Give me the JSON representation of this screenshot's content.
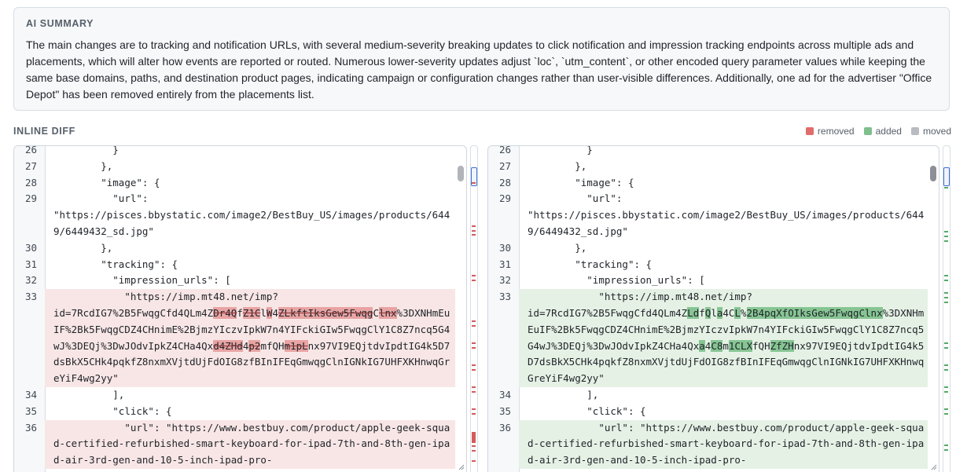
{
  "summary": {
    "title": "AI SUMMARY",
    "text": "The main changes are to tracking and notification URLs, with several medium-severity breaking updates to click notification and impression tracking endpoints across multiple ads and placements, which will alter how events are reported or routed. Numerous lower-severity updates adjust `loc`, `utm_content`, or other encoded query parameter values while keeping the same base domains, paths, and destination product pages, indicating campaign or configuration changes rather than user-visible differences. Additionally, one ad for the advertiser \"Office Depot\" has been removed entirely from the placements list."
  },
  "diff": {
    "title": "INLINE DIFF",
    "legend": [
      {
        "label": "removed",
        "color": "#e06c6c"
      },
      {
        "label": "added",
        "color": "#7fbf8c"
      },
      {
        "label": "moved",
        "color": "#b8bcc2"
      }
    ],
    "colors": {
      "removed_bg": "#f8e6e6",
      "added_bg": "#e6f1e6",
      "removed_hl": "#e9a3a3",
      "added_hl": "#86c593"
    },
    "left": [
      {
        "n": "26",
        "t": "normal",
        "segs": [
          [
            "",
            "          }"
          ]
        ]
      },
      {
        "n": "27",
        "t": "normal",
        "segs": [
          [
            "",
            "        },"
          ]
        ]
      },
      {
        "n": "28",
        "t": "normal",
        "segs": [
          [
            "",
            "        \"image\": {"
          ]
        ]
      },
      {
        "n": "29",
        "t": "normal",
        "segs": [
          [
            "",
            "          \"url\":\n\"https://pisces.bbystatic.com/image2/BestBuy_US/images/products/6449/6449432_sd.jpg\""
          ]
        ]
      },
      {
        "n": "30",
        "t": "normal",
        "segs": [
          [
            "",
            "        },"
          ]
        ]
      },
      {
        "n": "31",
        "t": "normal",
        "segs": [
          [
            "",
            "        \"tracking\": {"
          ]
        ]
      },
      {
        "n": "32",
        "t": "normal",
        "segs": [
          [
            "",
            "          \"impression_urls\": ["
          ]
        ]
      },
      {
        "n": "33",
        "t": "del",
        "segs": [
          [
            "",
            "            \"https://imp.mt48.net/imp?\nid=7RcdIG7%2B5FwqgCfd4QLm4Z"
          ],
          [
            "x",
            "Dr4Q"
          ],
          [
            "",
            "f"
          ],
          [
            "x",
            "Z1C"
          ],
          [
            "",
            "l"
          ],
          [
            "x",
            "W"
          ],
          [
            "",
            "4"
          ],
          [
            "x",
            "ZLkftIksGew5Fwqg"
          ],
          [
            "",
            "C"
          ],
          [
            "x",
            "lnx"
          ],
          [
            "",
            "%3DXNHmEuIF%2Bk5FwqgCDZ4CHnimE%2BjmzYIczvIpkW7n4YIFckiGIw5FwqgClY1C8Z7ncq5G4wJ%3DEQj%3DwJOdvIpkZ4CHa4Qx"
          ],
          [
            "x",
            "d4ZHd"
          ],
          [
            "",
            "4"
          ],
          [
            "x",
            "p2"
          ],
          [
            "",
            "mfQH"
          ],
          [
            "x",
            "m1pL"
          ],
          [
            "",
            "nx97VI9EQjtdvIpdtIG4k5D7dsBkX5CHk4pqkfZ8nxmXVjtdUjFdOIG8zfBInIFEqGmwqgClnIGNkIG7UHFXKHnwqGreYiF4wg2yy\""
          ]
        ]
      },
      {
        "n": "34",
        "t": "normal",
        "segs": [
          [
            "",
            "          ],"
          ]
        ]
      },
      {
        "n": "35",
        "t": "normal",
        "segs": [
          [
            "",
            "          \"click\": {"
          ]
        ]
      },
      {
        "n": "36",
        "t": "del",
        "segs": [
          [
            "",
            "            \"url\": \"https://www.bestbuy.com/product/apple-geek-squad-certified-refurbished-smart-keyboard-for-ipad-7th-and-8th-gen-ipad-air-3rd-gen-and-10-5-inch-ipad-pro-"
          ]
        ]
      }
    ],
    "right": [
      {
        "n": "26",
        "t": "normal",
        "segs": [
          [
            "",
            "          }"
          ]
        ]
      },
      {
        "n": "27",
        "t": "normal",
        "segs": [
          [
            "",
            "        },"
          ]
        ]
      },
      {
        "n": "28",
        "t": "normal",
        "segs": [
          [
            "",
            "        \"image\": {"
          ]
        ]
      },
      {
        "n": "29",
        "t": "normal",
        "segs": [
          [
            "",
            "          \"url\":\n\"https://pisces.bbystatic.com/image2/BestBuy_US/images/products/6449/6449432_sd.jpg\""
          ]
        ]
      },
      {
        "n": "30",
        "t": "normal",
        "segs": [
          [
            "",
            "        },"
          ]
        ]
      },
      {
        "n": "31",
        "t": "normal",
        "segs": [
          [
            "",
            "        \"tracking\": {"
          ]
        ]
      },
      {
        "n": "32",
        "t": "normal",
        "segs": [
          [
            "",
            "          \"impression_urls\": ["
          ]
        ]
      },
      {
        "n": "33",
        "t": "add",
        "segs": [
          [
            "",
            "            \"https://imp.mt48.net/imp?\nid=7RcdIG7%2B5FwqgCfd4QLm4Z"
          ],
          [
            "+",
            "Ld"
          ],
          [
            "",
            "f"
          ],
          [
            "+",
            "Q"
          ],
          [
            "",
            "l"
          ],
          [
            "+",
            "a"
          ],
          [
            "",
            "4C"
          ],
          [
            "+",
            "L"
          ],
          [
            "",
            "%"
          ],
          [
            "+",
            "2B4pqXfOIksGew5FwqgClnx"
          ],
          [
            "",
            "%3DXNHmEuIF%2Bk5FwqgCDZ4CHnimE%2BjmzYIczvIpkW7n4YIFckiGIw5FwqgClY1C8Z7ncq5G4wJ%3DEQj%3DwJOdvIpkZ4CHa4Qx"
          ],
          [
            "+",
            "a"
          ],
          [
            "",
            "4"
          ],
          [
            "+",
            "C8"
          ],
          [
            "",
            "m"
          ],
          [
            "+",
            "1CLX"
          ],
          [
            "",
            "fQH"
          ],
          [
            "+",
            "ZfZH"
          ],
          [
            "",
            "nx97VI9EQjtdvIpdtIG4k5D7dsBkX5CHk4pqkfZ8nxmXVjtdUjFdOIG8zfBInIFEqGmwqgClnIGNkIG7UHFXKHnwqGreYiF4wg2yy\""
          ]
        ]
      },
      {
        "n": "34",
        "t": "normal",
        "segs": [
          [
            "",
            "          ],"
          ]
        ]
      },
      {
        "n": "35",
        "t": "normal",
        "segs": [
          [
            "",
            "          \"click\": {"
          ]
        ]
      },
      {
        "n": "36",
        "t": "add",
        "segs": [
          [
            "",
            "            \"url\": \"https://www.bestbuy.com/product/apple-geek-squad-certified-refurbished-smart-keyboard-for-ipad-7th-and-8th-gen-ipad-air-3rd-gen-and-10-5-inch-ipad-pro-"
          ]
        ]
      }
    ]
  }
}
